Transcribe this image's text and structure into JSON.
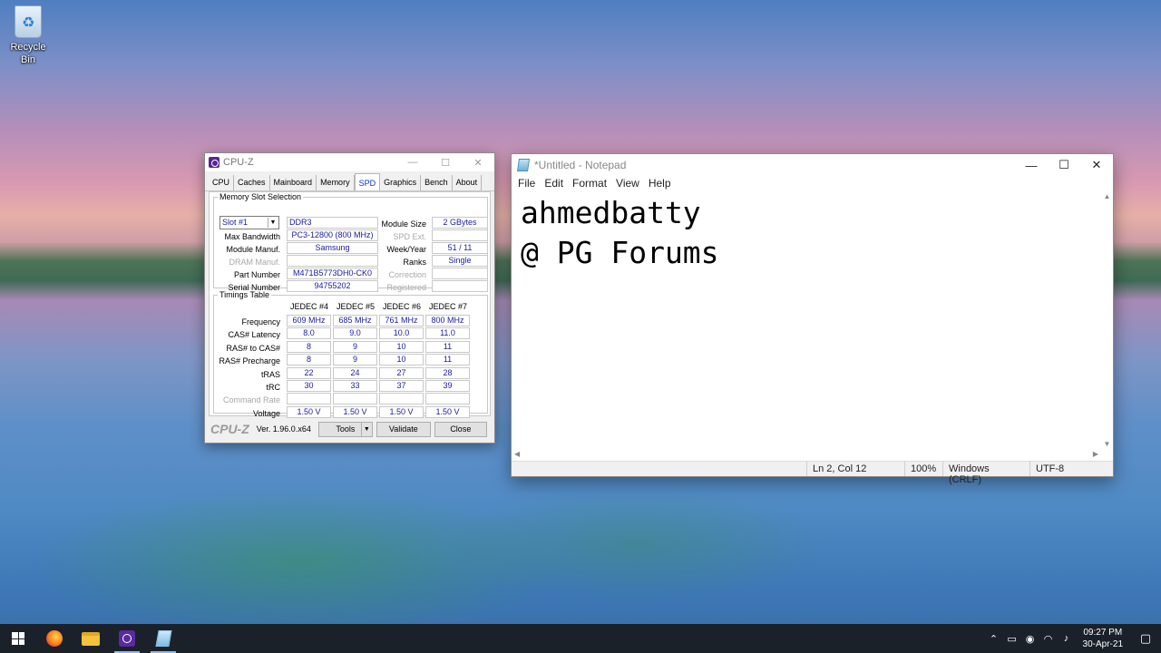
{
  "desktop": {
    "recycle_bin_label": "Recycle Bin"
  },
  "cpuz": {
    "title": "CPU-Z",
    "tabs": [
      "CPU",
      "Caches",
      "Mainboard",
      "Memory",
      "SPD",
      "Graphics",
      "Bench",
      "About"
    ],
    "active_tab": "SPD",
    "slot_group_label": "Memory Slot Selection",
    "slot_value": "Slot #1",
    "memory_type": "DDR3",
    "module_size_label": "Module Size",
    "module_size": "2 GBytes",
    "max_bandwidth_label": "Max Bandwidth",
    "max_bandwidth": "PC3-12800 (800 MHz)",
    "spd_ext_label": "SPD Ext.",
    "spd_ext": "",
    "module_manuf_label": "Module Manuf.",
    "module_manuf": "Samsung",
    "week_year_label": "Week/Year",
    "week_year": "51 / 11",
    "dram_manuf_label": "DRAM Manuf.",
    "dram_manuf": "",
    "ranks_label": "Ranks",
    "ranks": "Single",
    "part_number_label": "Part Number",
    "part_number": "M471B5773DH0-CK0",
    "correction_label": "Correction",
    "correction": "",
    "serial_number_label": "Serial Number",
    "serial_number": "94755202",
    "registered_label": "Registered",
    "registered": "",
    "timings_group_label": "Timings Table",
    "timing_columns": [
      "JEDEC #4",
      "JEDEC #5",
      "JEDEC #6",
      "JEDEC #7"
    ],
    "timing_rows": [
      {
        "label": "Frequency",
        "values": [
          "609 MHz",
          "685 MHz",
          "761 MHz",
          "800 MHz"
        ]
      },
      {
        "label": "CAS# Latency",
        "values": [
          "8.0",
          "9.0",
          "10.0",
          "11.0"
        ]
      },
      {
        "label": "RAS# to CAS#",
        "values": [
          "8",
          "9",
          "10",
          "11"
        ]
      },
      {
        "label": "RAS# Precharge",
        "values": [
          "8",
          "9",
          "10",
          "11"
        ]
      },
      {
        "label": "tRAS",
        "values": [
          "22",
          "24",
          "27",
          "28"
        ]
      },
      {
        "label": "tRC",
        "values": [
          "30",
          "33",
          "37",
          "39"
        ]
      },
      {
        "label": "Command Rate",
        "values": [
          "",
          "",
          "",
          ""
        ]
      },
      {
        "label": "Voltage",
        "values": [
          "1.50 V",
          "1.50 V",
          "1.50 V",
          "1.50 V"
        ]
      }
    ],
    "brand": "CPU-Z",
    "version": "Ver. 1.96.0.x64",
    "tools_label": "Tools",
    "validate_label": "Validate",
    "close_label": "Close"
  },
  "notepad": {
    "title": "*Untitled - Notepad",
    "menu": [
      "File",
      "Edit",
      "Format",
      "View",
      "Help"
    ],
    "content": "ahmedbatty\n@ PG Forums",
    "status_position": "Ln 2, Col 12",
    "status_zoom": "100%",
    "status_line_ending": "Windows (CRLF)",
    "status_encoding": "UTF-8"
  },
  "taskbar": {
    "time": "09:27 PM",
    "date": "30-Apr-21",
    "apps": [
      "start-icon",
      "firefox-icon",
      "file-explorer-icon",
      "cpuz-icon",
      "notepad-icon"
    ]
  }
}
